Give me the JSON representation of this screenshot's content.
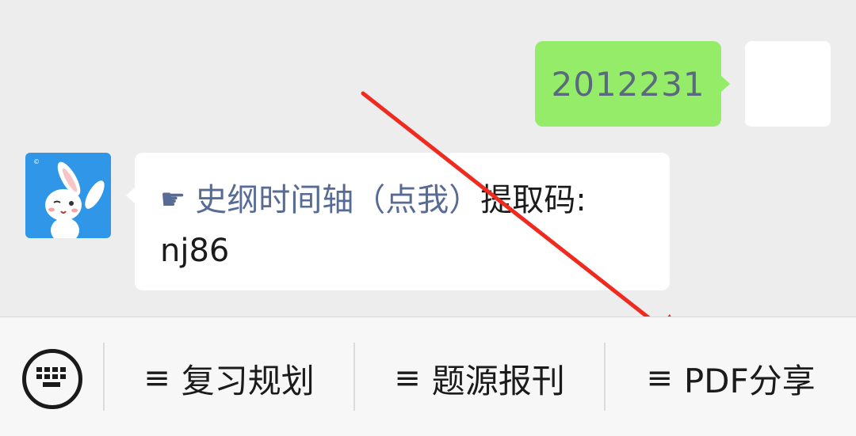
{
  "chat": {
    "outgoing": {
      "text": "2012231"
    },
    "incoming": {
      "hand_icon": "☛",
      "link_text": "史纲时间轴（点我）",
      "suffix": "提取码:",
      "second_line": "nj86"
    }
  },
  "bottom_menu": {
    "items": [
      {
        "icon": "≡",
        "label": "复习规划"
      },
      {
        "icon": "≡",
        "label": "题源报刊"
      },
      {
        "icon": "≡",
        "label": "PDF分享"
      }
    ]
  },
  "colors": {
    "chat_bg": "#ededed",
    "outgoing_bubble": "#95ec69",
    "link": "#576b95",
    "arrow": "#f02a1f",
    "avatar_bg": "#2f96e8"
  }
}
